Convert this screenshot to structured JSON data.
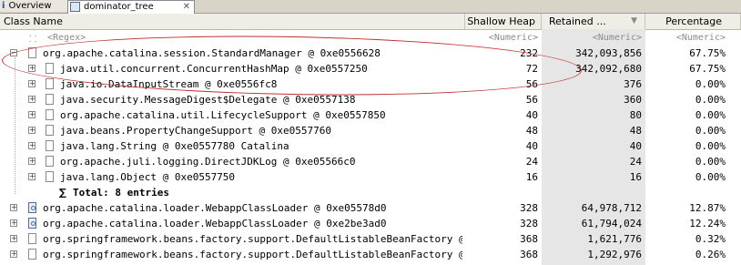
{
  "tabs": [
    {
      "label": "Overview"
    },
    {
      "label": "dominator_tree"
    }
  ],
  "columns": {
    "class_name": "Class Name",
    "shallow_heap": "Shallow Heap",
    "retained_heap": "Retained ...",
    "percentage": "Percentage"
  },
  "filter_row": {
    "name": "<Regex>",
    "shallow": "<Numeric>",
    "retained": "<Numeric>",
    "percentage": "<Numeric>"
  },
  "rows": [
    {
      "name": "org.apache.catalina.session.StandardManager @ 0xe0556628",
      "shallow": "232",
      "retained": "342,093,856",
      "percentage": "67.75%"
    },
    {
      "name": "java.util.concurrent.ConcurrentHashMap @ 0xe0557250",
      "shallow": "72",
      "retained": "342,092,680",
      "percentage": "67.75%"
    },
    {
      "name": "java.io.DataInputStream @ 0xe0556fc8",
      "shallow": "56",
      "retained": "376",
      "percentage": "0.00%"
    },
    {
      "name": "java.security.MessageDigest$Delegate @ 0xe0557138",
      "shallow": "56",
      "retained": "360",
      "percentage": "0.00%"
    },
    {
      "name": "org.apache.catalina.util.LifecycleSupport @ 0xe0557850",
      "shallow": "40",
      "retained": "80",
      "percentage": "0.00%"
    },
    {
      "name": "java.beans.PropertyChangeSupport @ 0xe0557760",
      "shallow": "48",
      "retained": "48",
      "percentage": "0.00%"
    },
    {
      "name": "java.lang.String @ 0xe0557780  Catalina",
      "shallow": "40",
      "retained": "40",
      "percentage": "0.00%"
    },
    {
      "name": "org.apache.juli.logging.DirectJDKLog @ 0xe05566c0",
      "shallow": "24",
      "retained": "24",
      "percentage": "0.00%"
    },
    {
      "name": "java.lang.Object @ 0xe0557750",
      "shallow": "16",
      "retained": "16",
      "percentage": "0.00%"
    },
    {
      "name": "Total: 8 entries",
      "shallow": "",
      "retained": "",
      "percentage": ""
    },
    {
      "name": "org.apache.catalina.loader.WebappClassLoader @ 0xe05578d0",
      "shallow": "328",
      "retained": "64,978,712",
      "percentage": "12.87%"
    },
    {
      "name": "org.apache.catalina.loader.WebappClassLoader @ 0xe2be3ad0",
      "shallow": "328",
      "retained": "61,794,024",
      "percentage": "12.24%"
    },
    {
      "name": "org.springframework.beans.factory.support.DefaultListableBeanFactory @ 0xe4f",
      "shallow": "368",
      "retained": "1,621,776",
      "percentage": "0.32%"
    },
    {
      "name": "org.springframework.beans.factory.support.DefaultListableBeanFactory @ 0xe2c",
      "shallow": "368",
      "retained": "1,292,976",
      "percentage": "0.26%"
    }
  ],
  "accent_colors": {
    "highlight_ellipse": "#c0312e",
    "retained_column_bg": "#e6e6e6"
  }
}
